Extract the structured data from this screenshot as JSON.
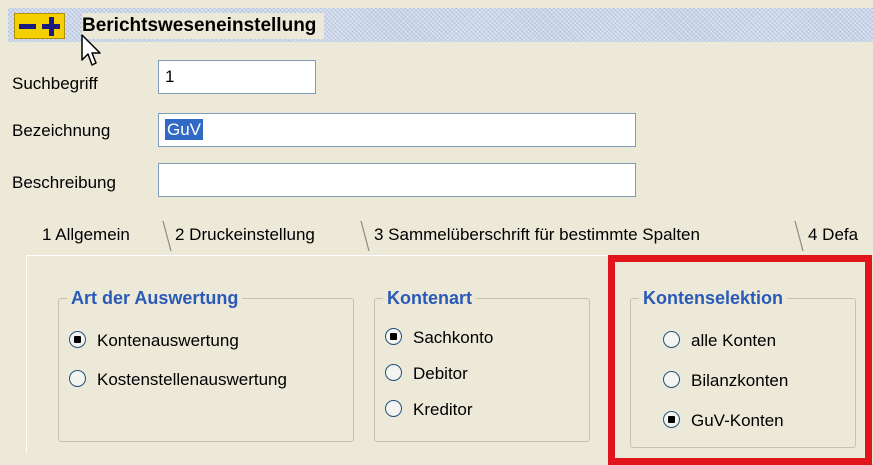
{
  "window": {
    "title": "Berichtsweseneinstellung",
    "icon": "minus-plus-icon"
  },
  "form": {
    "suchbegriff": {
      "label": "Suchbegriff",
      "value": "1"
    },
    "bezeichnung": {
      "label": "Bezeichnung",
      "value": "GuV"
    },
    "beschreibung": {
      "label": "Beschreibung",
      "value": ""
    }
  },
  "tabs": [
    {
      "label": "1 Allgemein",
      "active": true
    },
    {
      "label": "2 Druckeinstellung",
      "active": false
    },
    {
      "label": "3 Sammelüberschrift für bestimmte Spalten",
      "active": false
    },
    {
      "label": "4 Defa",
      "active": false
    }
  ],
  "groups": {
    "art_der_auswertung": {
      "title": "Art der Auswertung",
      "options": [
        {
          "label": "Kontenauswertung",
          "checked": true
        },
        {
          "label": "Kostenstellenauswertung",
          "checked": false
        }
      ]
    },
    "kontenart": {
      "title": "Kontenart",
      "options": [
        {
          "label": "Sachkonto",
          "checked": true
        },
        {
          "label": "Debitor",
          "checked": false
        },
        {
          "label": "Kreditor",
          "checked": false
        }
      ]
    },
    "kontenselektion": {
      "title": "Kontenselektion",
      "options": [
        {
          "label": "alle Konten",
          "checked": false
        },
        {
          "label": "Bilanzkonten",
          "checked": false
        },
        {
          "label": "GuV-Konten",
          "checked": true
        }
      ]
    }
  },
  "colors": {
    "highlight": "#e0141a",
    "group_title": "#2a5ab8",
    "selection": "#316ac5"
  }
}
